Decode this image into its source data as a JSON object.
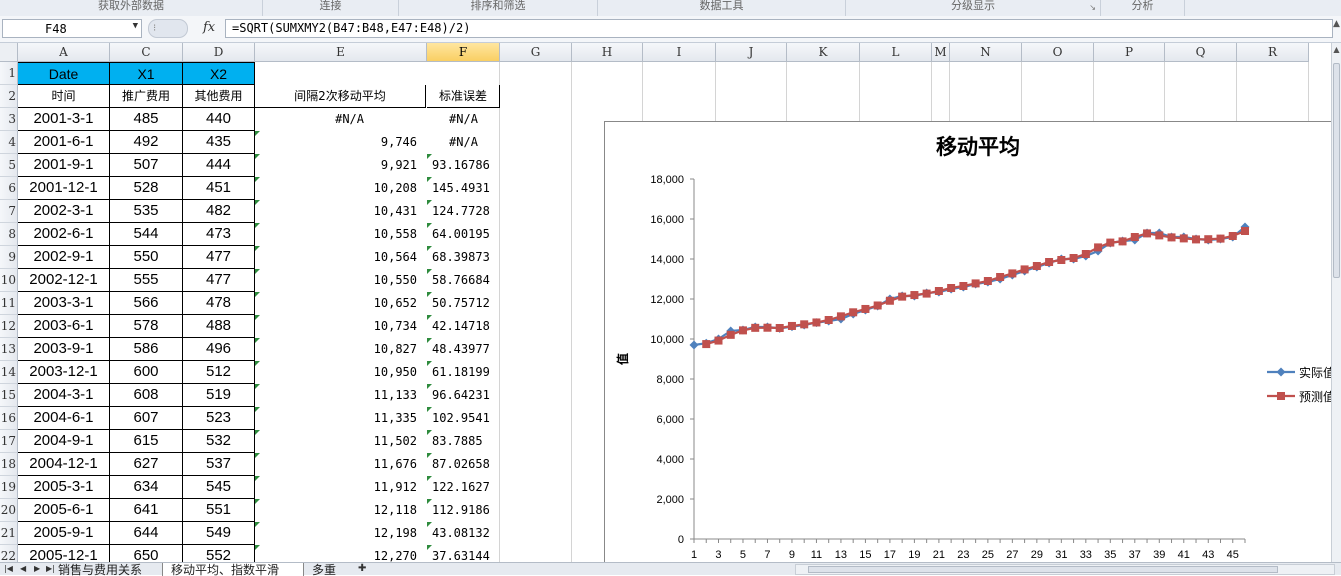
{
  "ribbon": {
    "groups": [
      "获取外部数据",
      "连接",
      "排序和筛选",
      "数据工具",
      "分级显示",
      "分析"
    ]
  },
  "formula_bar": {
    "name_box": "F48",
    "fx": "fx",
    "formula": "=SQRT(SUMXMY2(B47:B48,E47:E48)/2)"
  },
  "columns": [
    "A",
    "C",
    "D",
    "E",
    "F",
    "G",
    "H",
    "I",
    "J",
    "K",
    "L",
    "M",
    "N",
    "O",
    "P",
    "Q",
    "R"
  ],
  "active_column": "F",
  "rows": [
    "1",
    "2",
    "3",
    "4",
    "5",
    "6",
    "7",
    "8",
    "9",
    "10",
    "11",
    "12",
    "13",
    "14",
    "15",
    "16",
    "17",
    "18",
    "19",
    "20",
    "21",
    "22"
  ],
  "table": {
    "headers": [
      "Date",
      "X1",
      "X2"
    ],
    "subheaders": [
      "时间",
      "推广费用",
      "其他费用"
    ],
    "rows": [
      [
        "2001-3-1",
        "485",
        "440"
      ],
      [
        "2001-6-1",
        "492",
        "435"
      ],
      [
        "2001-9-1",
        "507",
        "444"
      ],
      [
        "2001-12-1",
        "528",
        "451"
      ],
      [
        "2002-3-1",
        "535",
        "482"
      ],
      [
        "2002-6-1",
        "544",
        "473"
      ],
      [
        "2002-9-1",
        "550",
        "477"
      ],
      [
        "2002-12-1",
        "555",
        "477"
      ],
      [
        "2003-3-1",
        "566",
        "478"
      ],
      [
        "2003-6-1",
        "578",
        "488"
      ],
      [
        "2003-9-1",
        "586",
        "496"
      ],
      [
        "2003-12-1",
        "600",
        "512"
      ],
      [
        "2004-3-1",
        "608",
        "519"
      ],
      [
        "2004-6-1",
        "607",
        "523"
      ],
      [
        "2004-9-1",
        "615",
        "532"
      ],
      [
        "2004-12-1",
        "627",
        "537"
      ],
      [
        "2005-3-1",
        "634",
        "545"
      ],
      [
        "2005-6-1",
        "641",
        "551"
      ],
      [
        "2005-9-1",
        "644",
        "549"
      ],
      [
        "2005-12-1",
        "650",
        "552"
      ]
    ]
  },
  "moving_avg": {
    "header_e": "间隔2次移动平均",
    "header_f": "标准误差",
    "e_values": [
      "#N/A",
      "9,746",
      "9,921",
      "10,208",
      "10,431",
      "10,558",
      "10,564",
      "10,550",
      "10,652",
      "10,734",
      "10,827",
      "10,950",
      "11,133",
      "11,335",
      "11,502",
      "11,676",
      "11,912",
      "12,118",
      "12,198",
      "12,270"
    ],
    "f_values": [
      "#N/A",
      "#N/A",
      "93.16786",
      "145.4931",
      "124.7728",
      "64.00195",
      "68.39873",
      "58.76684",
      "50.75712",
      "42.14718",
      "48.43977",
      "61.18199",
      "96.64231",
      "102.9541",
      "83.7885",
      "87.02658",
      "122.1627",
      "112.9186",
      "43.08132",
      "37.63144"
    ]
  },
  "chart_data": {
    "type": "line",
    "title": "移动平均",
    "ylabel": "值",
    "xlabel": "",
    "ylim": [
      0,
      18000
    ],
    "yticks": [
      "0",
      "2,000",
      "4,000",
      "6,000",
      "8,000",
      "10,000",
      "12,000",
      "14,000",
      "16,000",
      "18,000"
    ],
    "xticks": [
      "1",
      "3",
      "5",
      "7",
      "9",
      "11",
      "13",
      "15",
      "17",
      "19",
      "21",
      "23",
      "25",
      "27",
      "29",
      "31",
      "33",
      "35",
      "37",
      "39",
      "41",
      "43",
      "45"
    ],
    "legend_position": "right",
    "series": [
      {
        "name": "实际值",
        "color": "#4f81bd",
        "marker": "diamond",
        "values": [
          9700,
          9790,
          10000,
          10400,
          10450,
          10600,
          10600,
          10530,
          10620,
          10700,
          10820,
          10900,
          11000,
          11250,
          11450,
          11650,
          12000,
          12150,
          12150,
          12300,
          12350,
          12500,
          12600,
          12750,
          12850,
          13000,
          13200,
          13400,
          13600,
          13800,
          14000,
          14000,
          14150,
          14400,
          14800,
          14900,
          14950,
          15300,
          15300,
          15100,
          15100,
          15000,
          14950,
          15000,
          15100,
          15600
        ]
      },
      {
        "name": "预测值",
        "color": "#c0504d",
        "marker": "square",
        "values": [
          null,
          9746,
          9921,
          10208,
          10431,
          10558,
          10564,
          10550,
          10652,
          10734,
          10827,
          10950,
          11133,
          11335,
          11502,
          11676,
          11912,
          12118,
          12198,
          12270,
          12400,
          12550,
          12650,
          12780,
          12900,
          13100,
          13280,
          13480,
          13650,
          13850,
          13950,
          14050,
          14250,
          14580,
          14820,
          14880,
          15100,
          15280,
          15180,
          15080,
          15030,
          14980,
          14990,
          15020,
          15150,
          15400
        ]
      }
    ]
  },
  "sheet_tabs": [
    "销售与费用关系",
    "移动平均、指数平滑",
    "多重"
  ],
  "active_tab": 1
}
